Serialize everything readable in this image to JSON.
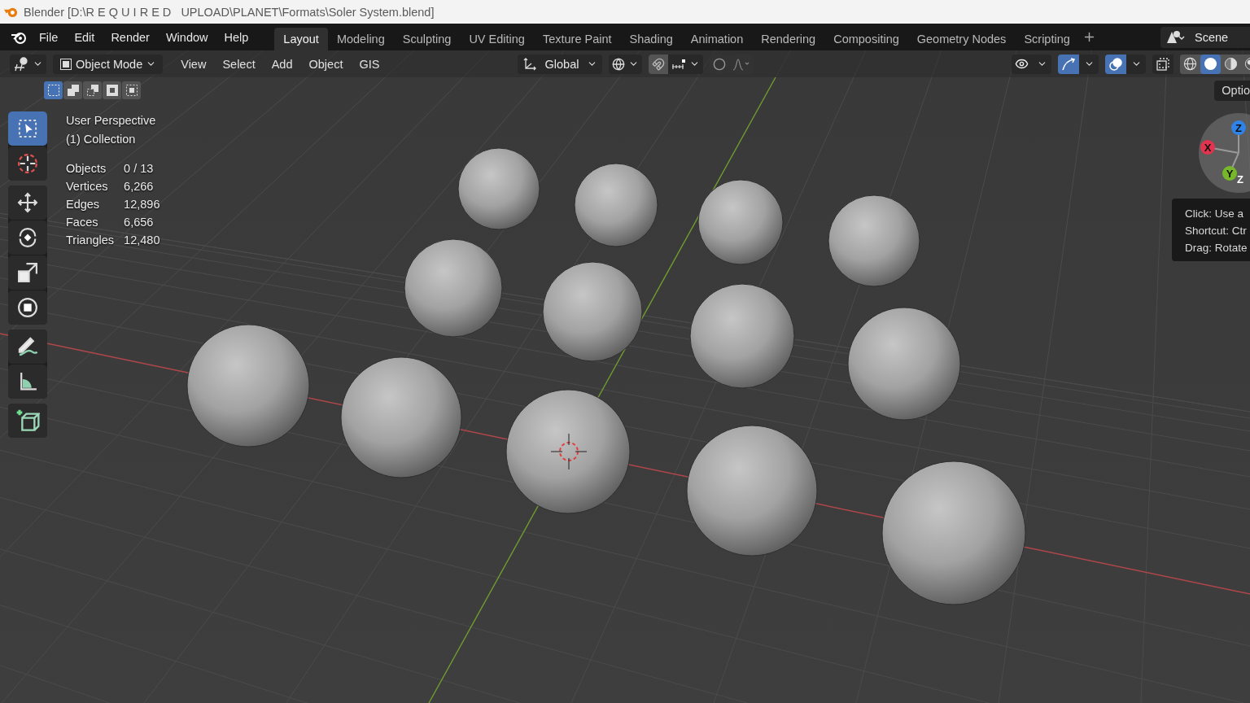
{
  "window": {
    "title": "Blender [D:\\R E Q U I R E D   UPLOAD\\PLANET\\Formats\\Soler System.blend]"
  },
  "menu": [
    "File",
    "Edit",
    "Render",
    "Window",
    "Help"
  ],
  "workspaces": [
    {
      "label": "Layout",
      "selected": true
    },
    {
      "label": "Modeling",
      "selected": false
    },
    {
      "label": "Sculpting",
      "selected": false
    },
    {
      "label": "UV Editing",
      "selected": false
    },
    {
      "label": "Texture Paint",
      "selected": false
    },
    {
      "label": "Shading",
      "selected": false
    },
    {
      "label": "Animation",
      "selected": false
    },
    {
      "label": "Rendering",
      "selected": false
    },
    {
      "label": "Compositing",
      "selected": false
    },
    {
      "label": "Geometry Nodes",
      "selected": false
    },
    {
      "label": "Scripting",
      "selected": false
    }
  ],
  "scene": "Scene",
  "header": {
    "mode": "Object Mode",
    "menus": [
      "View",
      "Select",
      "Add",
      "Object",
      "GIS"
    ],
    "orientation": "Global",
    "snapping": {
      "on": true
    },
    "proportional": {
      "on": false
    },
    "view_toggles": [
      {
        "kind": "visibility",
        "on": false
      },
      {
        "kind": "gizmo",
        "on": true
      },
      {
        "kind": "overlays",
        "on": true
      },
      {
        "kind": "xray",
        "on": false
      }
    ],
    "shading": [
      {
        "kind": "wireframe",
        "selected": false
      },
      {
        "kind": "solid",
        "selected": true
      },
      {
        "kind": "material",
        "selected": false
      },
      {
        "kind": "rendered",
        "selected": false
      }
    ]
  },
  "select_modes": [
    {
      "kind": "set",
      "selected": true
    },
    {
      "kind": "extend",
      "selected": false
    },
    {
      "kind": "subtract",
      "selected": false
    },
    {
      "kind": "invert",
      "selected": false
    },
    {
      "kind": "intersect",
      "selected": false
    }
  ],
  "tool_groups": [
    {
      "tools": [
        {
          "kind": "select",
          "selected": true
        },
        {
          "kind": "cursor",
          "selected": false
        }
      ]
    },
    {
      "tools": [
        {
          "kind": "move",
          "selected": false
        },
        {
          "kind": "rotate",
          "selected": false
        },
        {
          "kind": "scale",
          "selected": false
        },
        {
          "kind": "transform",
          "selected": false
        }
      ]
    },
    {
      "tools": [
        {
          "kind": "annotate",
          "selected": false
        },
        {
          "kind": "measure",
          "selected": false
        }
      ]
    },
    {
      "tools": [
        {
          "kind": "add",
          "selected": false
        }
      ]
    }
  ],
  "viewport_info": {
    "view": "User Perspective",
    "collection": "(1) Collection"
  },
  "stats": [
    {
      "label": "Objects",
      "value": "0 / 13"
    },
    {
      "label": "Vertices",
      "value": "6,266"
    },
    {
      "label": "Edges",
      "value": "12,896"
    },
    {
      "label": "Faces",
      "value": "6,656"
    },
    {
      "label": "Triangles",
      "value": "12,480"
    }
  ],
  "options_button": "Optio",
  "gizmo": {
    "axes": [
      {
        "label": "X",
        "kind": "positive",
        "color": "#e2334f"
      },
      {
        "label": "Z",
        "kind": "positive",
        "color": "#2f83e8"
      },
      {
        "label": "Y",
        "kind": "positive",
        "color": "#76b82a"
      },
      {
        "label": "Z",
        "kind": "negative",
        "color": "#ffffff"
      }
    ]
  },
  "tooltip": [
    "Click: Use a",
    "Shortcut: Ctr",
    "Drag: Rotate"
  ]
}
